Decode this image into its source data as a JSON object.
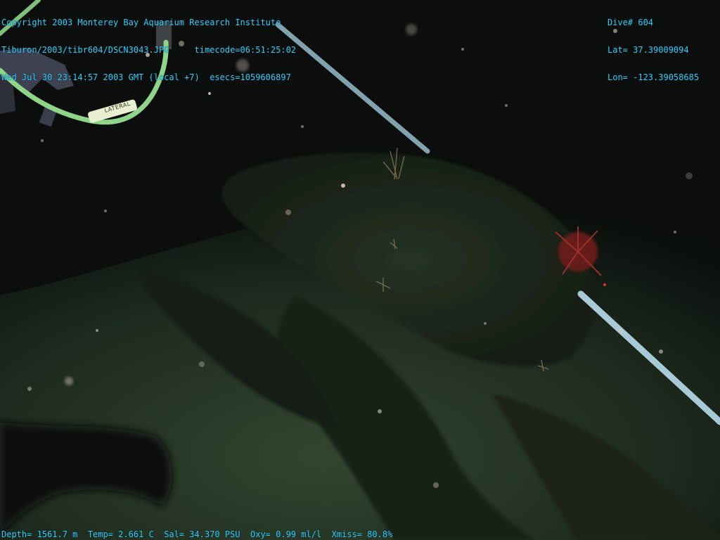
{
  "overlay": {
    "top_left": [
      "Copyright 2003 Monterey Bay Aquarium Research Institute",
      "Tiburon/2003/tibr604/DSCN3043.JPG     timecode=06:51:25:02",
      "Wed Jul 30 23:14:57 2003 GMT (local +7)  esecs=1059606897"
    ],
    "top_right": [
      "Dive# 604",
      "Lat= 37.39009094",
      "Lon= -123.39058685"
    ],
    "bottom": "Depth= 1561.7 m  Temp= 2.661 C  Sal= 34.370 PSU  Oxy= 0.99 ml/l  Xmiss= 80.8%",
    "cable_label": "LATERAL"
  },
  "colors": {
    "overlay_text": "#2fd1ff",
    "water": "#0b0f0d",
    "sediment": "#2a3a2c",
    "rock": "#1a2218",
    "laser_pole": "#9fc4cf",
    "cable": "#8fd48a",
    "crinoid": "#8a2a22"
  },
  "icons": {
    "rov_arm": "manipulator-arm-icon"
  }
}
